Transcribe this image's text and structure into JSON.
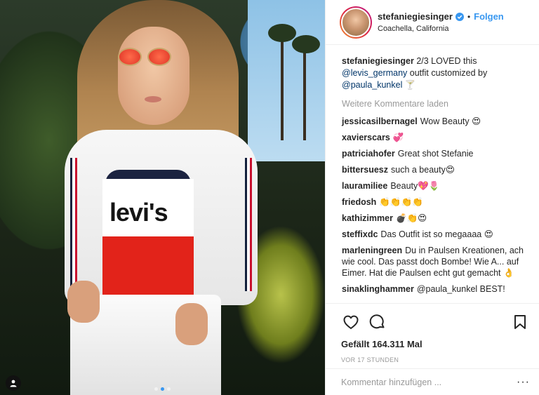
{
  "post": {
    "username": "stefaniegiesinger",
    "follow_label": "Folgen",
    "dot": "•",
    "location": "Coachella, California"
  },
  "caption": {
    "username": "stefaniegiesinger",
    "text_part1": "2/3 LOVED this",
    "mention1": "@levis_germany",
    "text_part2": "outfit customized by",
    "mention2": "@paula_kunkel",
    "emoji": "🍸"
  },
  "load_more_label": "Weitere Kommentare laden",
  "comments": [
    {
      "user": "jessicasilbernagel",
      "text": "Wow Beauty 😍"
    },
    {
      "user": "xavierscars",
      "text": "💞"
    },
    {
      "user": "patriciahofer",
      "text": "Great shot Stefanie"
    },
    {
      "user": "bittersuesz",
      "text": "such a beauty😍"
    },
    {
      "user": "laurami­liee",
      "text": "Beauty💖🌷"
    },
    {
      "user": "friedosh",
      "text": "👏👏👏👏"
    },
    {
      "user": "kathizimmer",
      "text": "💣👏😍"
    },
    {
      "user": "steffixdc",
      "text": "Das Outfit ist so megaaaa 😍"
    },
    {
      "user": "marleningreen",
      "text": "Du in Paulsen Kreationen, ach wie cool. Das passt doch Bombe! Wie A... auf Eimer. Hat die Paulsen echt gut gemacht 👌"
    },
    {
      "user": "sinaklinghammer",
      "text": "@paula_kunkel BEST!"
    }
  ],
  "likes_label": "Gefällt 164.311 Mal",
  "time_label": "VOR 17 STUNDEN",
  "comment_input": {
    "placeholder": "Kommentar hinzufügen ..."
  },
  "more_options": "···",
  "icons": {
    "like": "heart-icon",
    "comment": "comment-icon",
    "save": "bookmark-icon",
    "verified": "verified-badge-icon",
    "tag": "user-tag-icon"
  },
  "colors": {
    "link": "#3897f0",
    "mention": "#003569",
    "muted": "#999999",
    "text": "#262626"
  },
  "carousel": {
    "count": 3,
    "active": 2
  }
}
